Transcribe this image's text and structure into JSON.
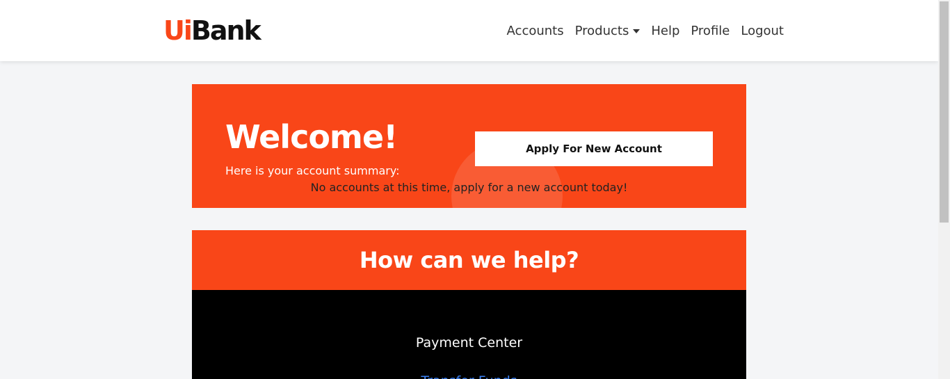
{
  "brand": {
    "part1": "Ui",
    "part2": "Bank",
    "accent_color": "#f94618"
  },
  "nav": {
    "accounts": "Accounts",
    "products": "Products",
    "help": "Help",
    "profile": "Profile",
    "logout": "Logout"
  },
  "welcome": {
    "title": "Welcome!",
    "summary": "Here is your account summary:",
    "apply_button": "Apply For New Account",
    "no_accounts": "No accounts at this time, apply for a new account today!"
  },
  "help": {
    "title": "How can we help?",
    "payment_center": "Payment Center",
    "transfer_funds": "Transfer Funds"
  }
}
